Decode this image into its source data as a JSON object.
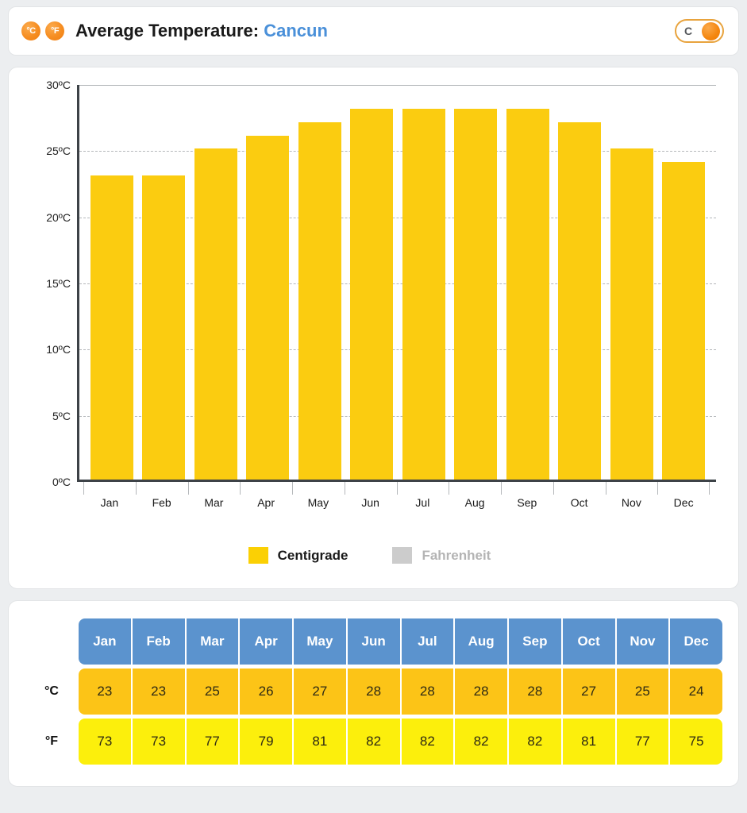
{
  "header": {
    "unit_badges": [
      {
        "icon": "celsius-badge-icon",
        "label": "°C"
      },
      {
        "icon": "fahrenheit-badge-icon",
        "label": "°F"
      }
    ],
    "title_prefix": "Average Temperature:",
    "city": "Cancun",
    "toggle": {
      "label": "C",
      "state": "celsius"
    }
  },
  "chart_data": {
    "type": "bar",
    "title": "Average Temperature: Cancun",
    "categories": [
      "Jan",
      "Feb",
      "Mar",
      "Apr",
      "May",
      "Jun",
      "Jul",
      "Aug",
      "Sep",
      "Oct",
      "Nov",
      "Dec"
    ],
    "series": [
      {
        "name": "Centigrade",
        "values": [
          23,
          23,
          25,
          26,
          27,
          28,
          28,
          28,
          28,
          27,
          25,
          24
        ],
        "color": "#fbcc10",
        "active": true
      },
      {
        "name": "Fahrenheit",
        "values": [
          73,
          73,
          77,
          79,
          81,
          82,
          82,
          82,
          82,
          81,
          77,
          75
        ],
        "color": "#cccccc",
        "active": false
      }
    ],
    "xlabel": "",
    "ylabel": "",
    "ylim": [
      0,
      30
    ],
    "yticks": [
      0,
      5,
      10,
      15,
      20,
      25,
      30
    ],
    "ytick_labels": [
      "0ºC",
      "5ºC",
      "10ºC",
      "15ºC",
      "20ºC",
      "25ºC",
      "30ºC"
    ],
    "grid": true,
    "legend_position": "bottom"
  },
  "legend": {
    "centigrade": "Centigrade",
    "fahrenheit": "Fahrenheit"
  },
  "table": {
    "months": [
      "Jan",
      "Feb",
      "Mar",
      "Apr",
      "May",
      "Jun",
      "Jul",
      "Aug",
      "Sep",
      "Oct",
      "Nov",
      "Dec"
    ],
    "celsius_label": "°C",
    "fahrenheit_label": "°F",
    "celsius": [
      "23",
      "23",
      "25",
      "26",
      "27",
      "28",
      "28",
      "28",
      "28",
      "27",
      "25",
      "24"
    ],
    "fahrenheit": [
      "73",
      "73",
      "77",
      "79",
      "81",
      "82",
      "82",
      "82",
      "82",
      "81",
      "77",
      "75"
    ]
  },
  "colors": {
    "bar": "#fbcc10",
    "table_header": "#5b93ce",
    "table_celsius": "#fcc417",
    "table_fahrenheit": "#fcef0c",
    "city_link": "#4a90d9",
    "accent_orange": "#f4860e"
  }
}
